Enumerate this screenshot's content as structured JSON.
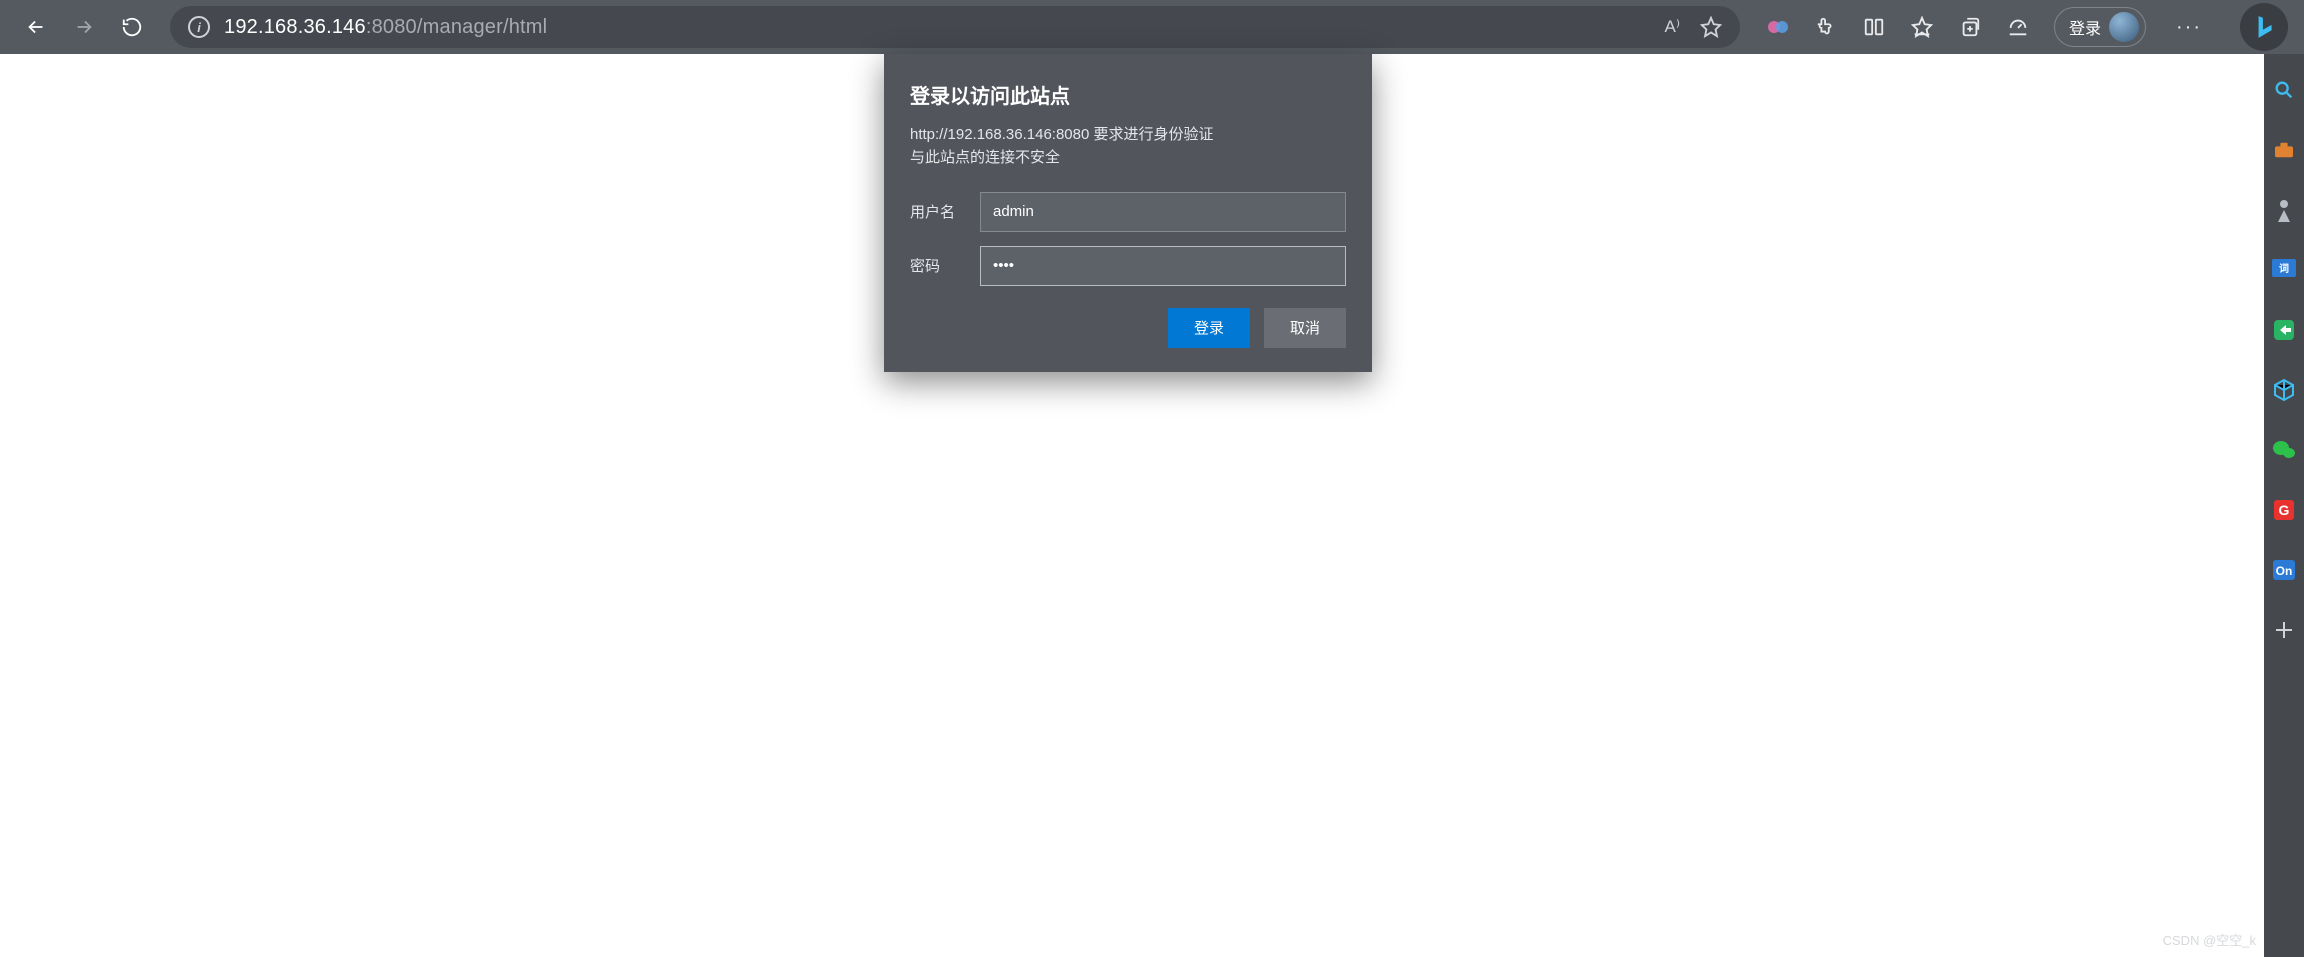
{
  "toolbar": {
    "url_host": "192.168.36.146",
    "url_port_path": ":8080/manager/html",
    "readaloud": "A⁾",
    "login_label": "登录",
    "more": "···"
  },
  "dialog": {
    "title": "登录以访问此站点",
    "message_line1": "http://192.168.36.146:8080 要求进行身份验证",
    "message_line2": "与此站点的连接不安全",
    "username_label": "用户名",
    "username_value": "admin",
    "password_label": "密码",
    "password_value": "••••",
    "login_btn": "登录",
    "cancel_btn": "取消"
  },
  "sidebar": {
    "items": [
      "search",
      "toolbox",
      "chess",
      "translate",
      "share",
      "cube",
      "wechat",
      "gdoc",
      "onenote",
      "add"
    ]
  },
  "watermark": "CSDN @空空_k"
}
